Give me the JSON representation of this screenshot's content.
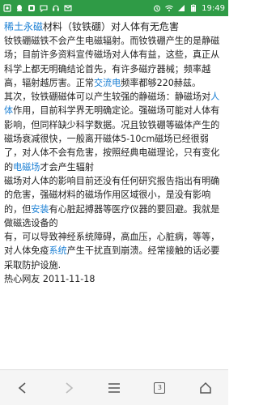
{
  "status_bar": {
    "time": "19:49",
    "left_icons": [
      "notification-icon",
      "qq-icon",
      "app-icon",
      "message-icon",
      "headset-icon",
      "mail-icon"
    ],
    "right_icons": [
      "alarm-icon",
      "wifi-icon",
      "signal-icon",
      "battery-icon"
    ]
  },
  "article": {
    "title_link": "稀土永磁",
    "title_rest": "材料（钕铁硼）对人体有无危害",
    "para1_a": "钕铁硼磁铁不会产生电磁辐射。而钕铁硼产生的是静磁场；目前许多资料宣传磁场对人体有益，这些，真正从科学上都无明确结论首先，有许多磁疗器械；频率越高，辐射越厉害。正常",
    "para1_link": "交流电",
    "para1_b": "频率都够220赫兹。",
    "para2_a": "其次，钕铁硼磁体可以产生较强的静磁场：静磁场对",
    "para2_link1": "人体",
    "para2_b": "作用，目前科学界无明确定论。强磁场可能对人体有影响，但同样缺少科学数据。况且钕铁硼等磁体产生的磁场衰减很快，一般离开磁体5-10cm磁场已经很弱了，对人体不会有危害，按照经典电磁理论，只有变化的",
    "para2_link2": "电磁场",
    "para2_c": "才会产生辐射",
    "para3_a": "磁场对人体的影响目前还没有任何研究报告指出有明确的危害，强磁材料的磁场作用区域很小，是没有影响的，但",
    "para3_link1": "安装",
    "para3_b": "有心脏起搏器等医疗仪器的要回避。我就是做磁选设备的",
    "para3_c": "有，可以导致神经系统障碍，高血压，心脏病，等等，对人体免疫",
    "para3_link2": "系统",
    "para3_d": "产生干扰直到崩溃。经常接触的话必要采取防护设施.",
    "byline": "热心网友 2011-11-18"
  },
  "nav": {
    "tab_count": "3"
  },
  "colors": {
    "status_bar": "#2f9b46",
    "link": "#1a7fd4",
    "text": "#222222"
  }
}
